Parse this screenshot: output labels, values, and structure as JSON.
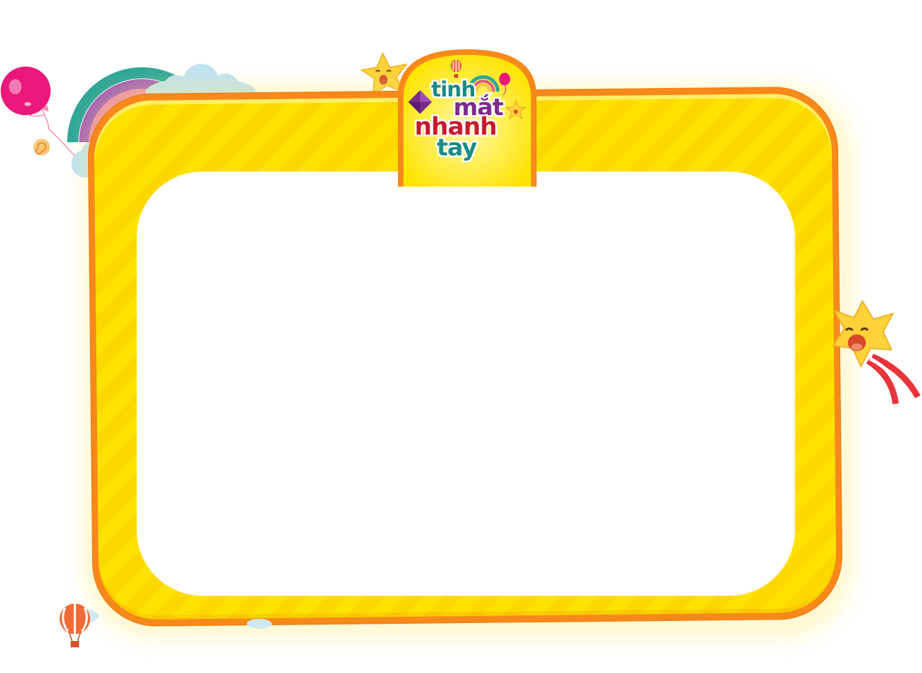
{
  "logo": {
    "line1": "tinh",
    "line2": "mắt",
    "line3": "nhanh",
    "line4": "tay"
  },
  "colors": {
    "frame_border": "#f7891b",
    "frame_fill": "#ffe300",
    "frame_stripe": "#fdd800",
    "panel": "#ffffff",
    "logo_teal": "#1c8a86",
    "logo_purple": "#7b2b8e",
    "logo_red": "#c71a2e",
    "balloon_pink": "#e9187a",
    "star_yellow": "#ffd23a"
  },
  "decorations": [
    "balloon-icon",
    "rainbow-icon",
    "cloud-icon",
    "star-mascot-icon",
    "hot-air-balloon-icon",
    "kite-icon",
    "candy-icon",
    "ribbon-icon"
  ]
}
